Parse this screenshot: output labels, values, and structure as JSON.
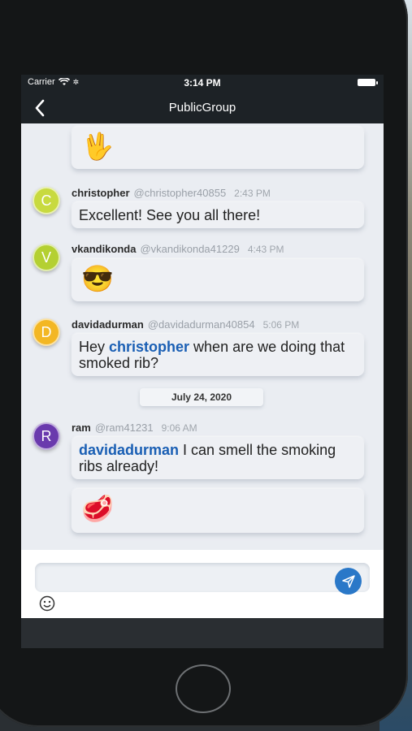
{
  "status": {
    "carrier": "Carrier",
    "time": "3:14 PM"
  },
  "nav": {
    "title": "PublicGroup",
    "back_icon": "chevron-left-icon"
  },
  "messages": [
    {
      "emoji": "🖖"
    },
    {
      "avatar": "C",
      "avatar_color": "#c8da3f",
      "name": "christopher",
      "handle": "@christopher40855",
      "time": "2:43 PM",
      "text": "Excellent! See you all there!"
    },
    {
      "avatar": "V",
      "avatar_color": "#b4d032",
      "name": "vkandikonda",
      "handle": "@vkandikonda41229",
      "time": "4:43 PM",
      "emoji": "😎"
    },
    {
      "avatar": "D",
      "avatar_color": "#f3b724",
      "name": "davidadurman",
      "handle": "@davidadurman40854",
      "time": "5:06 PM",
      "text_pre": "Hey ",
      "mention": "christopher",
      "text_post": " when are we doing that smoked rib?"
    },
    {
      "avatar": "R",
      "avatar_color": "#6a3aad",
      "name": "ram",
      "handle": "@ram41231",
      "time": "9:06 AM",
      "mention": "davidadurman",
      "text_post": "  I can smell the smoking ribs already!",
      "emoji": "🥩"
    }
  ],
  "date_separator": "July 24, 2020",
  "composer": {
    "placeholder": "",
    "value": "",
    "send_icon": "send-icon",
    "emoji_icon": "smiley-icon"
  },
  "colors": {
    "accent": "#2a78c8",
    "mention": "#1a5fb4",
    "chat_bg": "#eaedf2"
  }
}
